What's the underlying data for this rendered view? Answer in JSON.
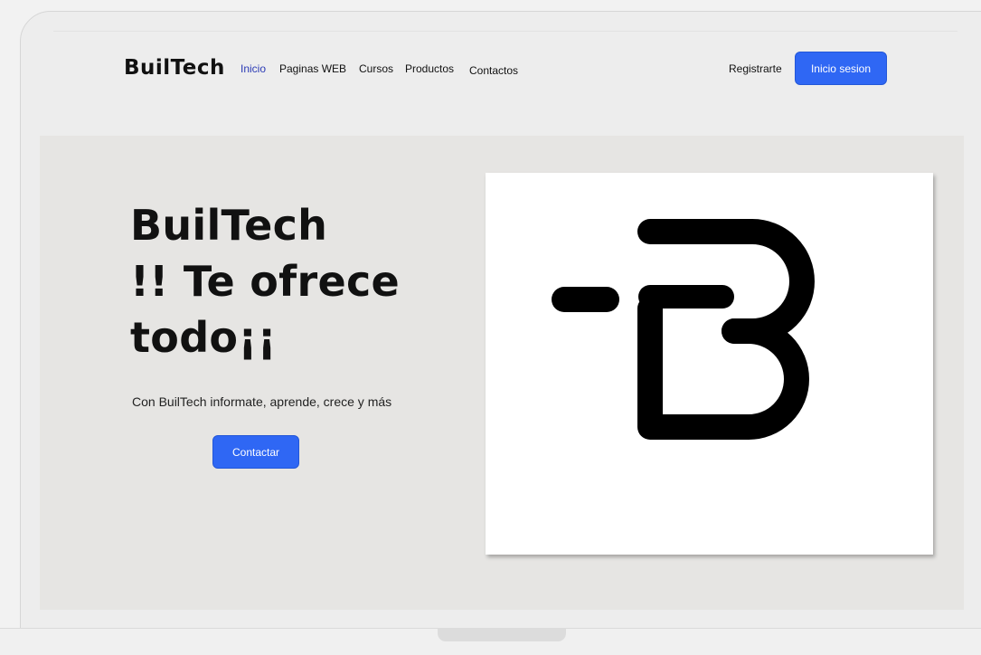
{
  "brand": {
    "name": "BuilTech"
  },
  "nav": {
    "items": [
      {
        "label": "Inicio",
        "active": true
      },
      {
        "label": "Paginas WEB",
        "active": false
      },
      {
        "label": "Cursos",
        "active": false
      },
      {
        "label": "Productos",
        "active": false
      },
      {
        "label": "Contactos",
        "active": false
      }
    ],
    "register_label": "Registrarte",
    "login_label": "Inicio sesion"
  },
  "hero": {
    "title_lines": [
      "BuilTech",
      "!! Te ofrece",
      "todo¡¡"
    ],
    "subtitle": "Con BuilTech informate, aprende, crece  y más",
    "contact_label": "Contactar",
    "logo_icon": "builtech-b-logo-icon"
  },
  "colors": {
    "accent": "#2f67f4",
    "active_link": "#2b3bb5",
    "hero_bg": "#e6e5e3",
    "page_bg": "#ededed"
  }
}
